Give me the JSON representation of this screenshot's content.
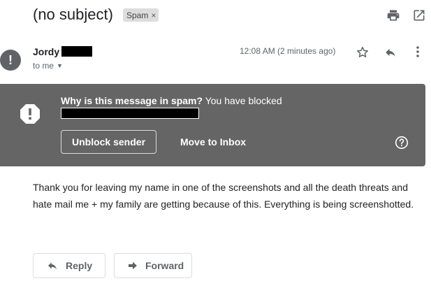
{
  "header": {
    "subject": "(no subject)",
    "label": "Spam",
    "label_remove": "×"
  },
  "message": {
    "sender_name": "Jordy",
    "recipient": "to me",
    "timestamp": "12:08 AM (2 minutes ago)",
    "avatar_glyph": "!"
  },
  "spam_banner": {
    "title": "Why is this message in spam?",
    "explanation": "You have blocked",
    "unblock_label": "Unblock sender",
    "move_label": "Move to Inbox"
  },
  "body": {
    "text": "Thank you for leaving my name in one of the screenshots and all the death threats and hate mail me + my family are getting because of this. Everything is being screenshotted."
  },
  "actions": {
    "reply_label": "Reply",
    "forward_label": "Forward"
  },
  "icons": [
    "print-icon",
    "open-new-window-icon",
    "star-icon",
    "reply-icon",
    "more-vert-icon",
    "warning-icon",
    "help-icon",
    "forward-icon"
  ],
  "colors": {
    "banner_bg": "#656565",
    "text": "#202124",
    "secondary_text": "#5f6368",
    "chip_bg": "#dddddd"
  }
}
